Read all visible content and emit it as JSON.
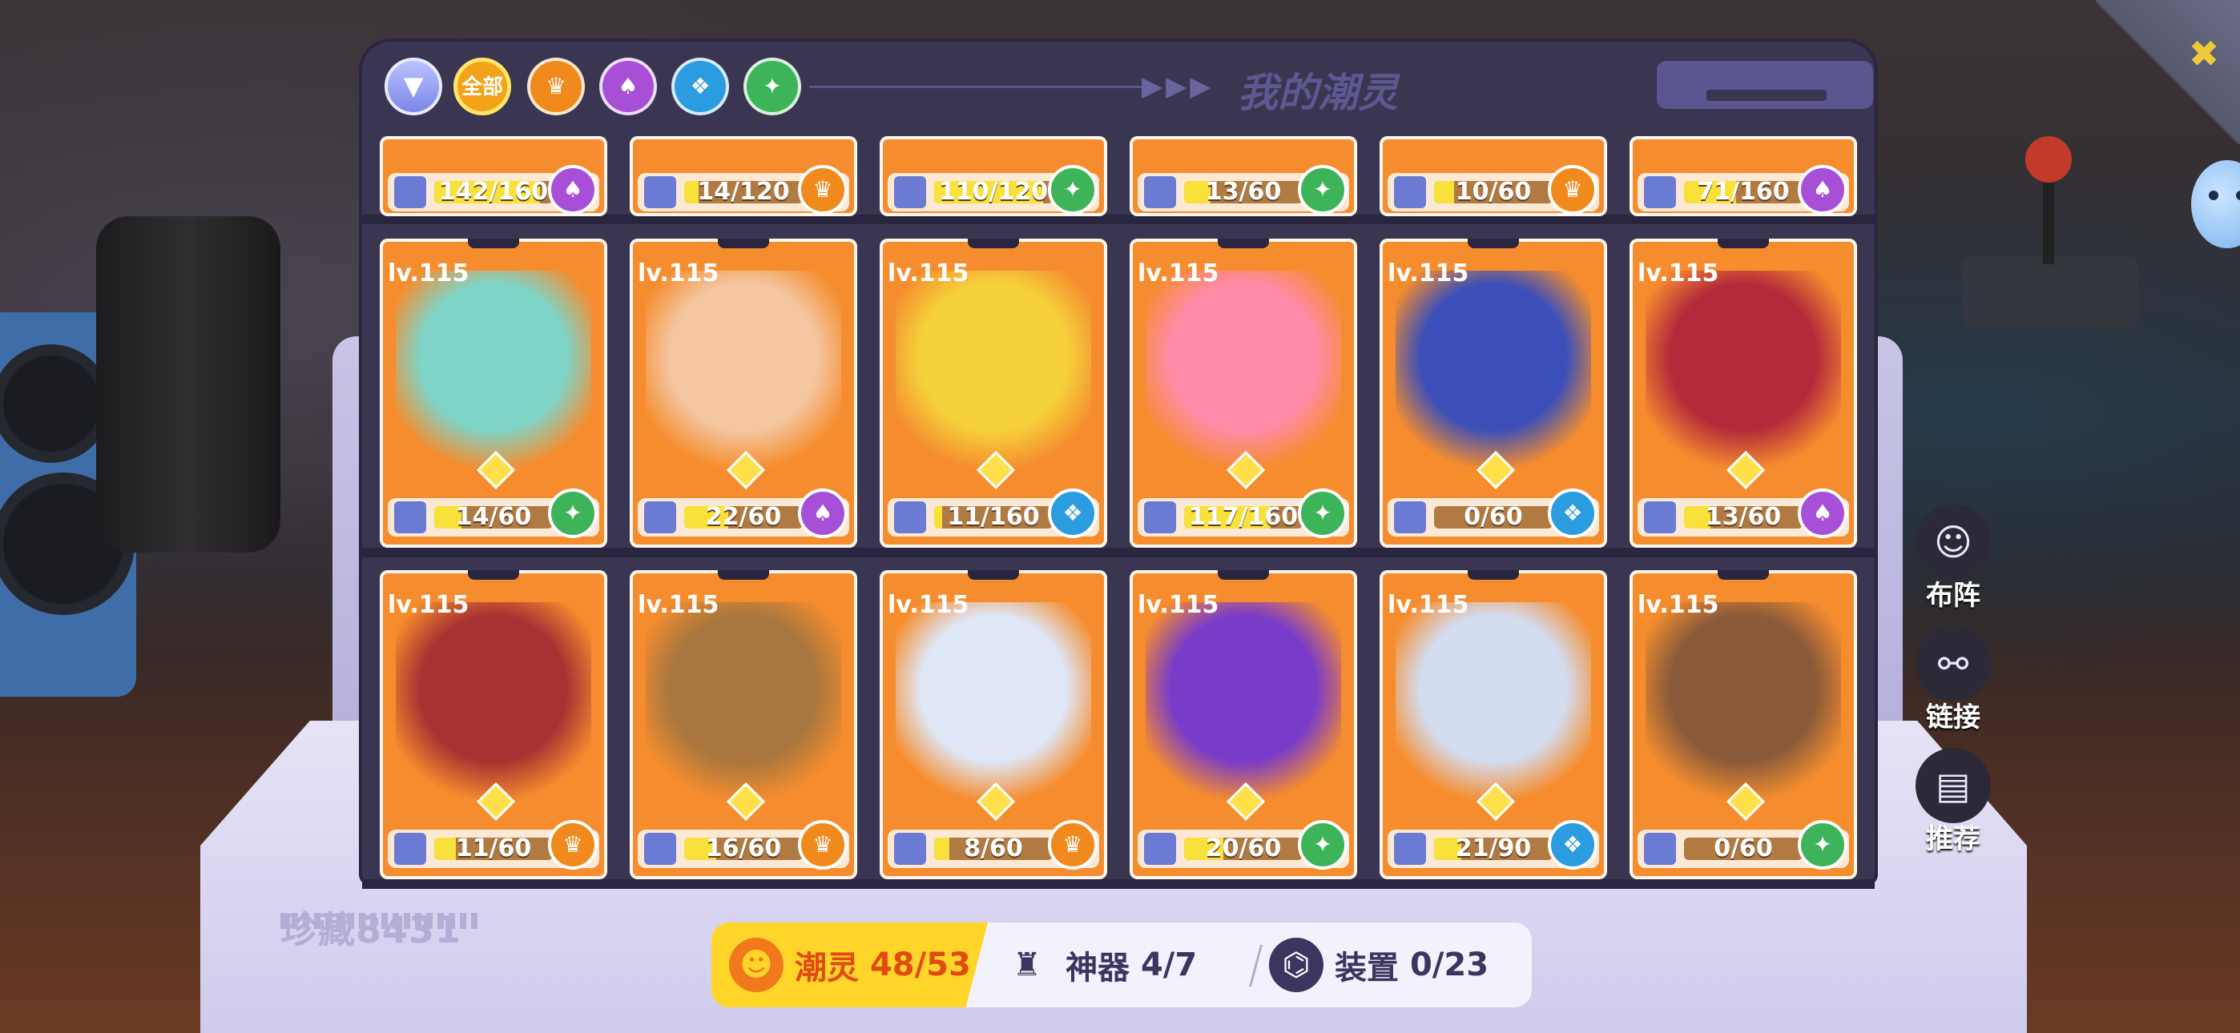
{
  "header": {
    "title": "我的潮灵",
    "filters": [
      {
        "label": "全部",
        "icon": "all-badge",
        "color": "#f2a31a"
      },
      {
        "icon": "orange-faction-icon",
        "color": "#f08a1c"
      },
      {
        "icon": "purple-faction-icon",
        "color": "#a84fd8"
      },
      {
        "icon": "blue-faction-icon",
        "color": "#2a9cdf"
      },
      {
        "icon": "green-faction-icon",
        "color": "#3db45a"
      }
    ]
  },
  "top_row": [
    {
      "count": "142/160",
      "fill": 0.89,
      "faction": "purple"
    },
    {
      "count": "14/120",
      "fill": 0.12,
      "faction": "orange"
    },
    {
      "count": "110/120",
      "fill": 0.92,
      "faction": "green"
    },
    {
      "count": "13/60",
      "fill": 0.22,
      "faction": "green"
    },
    {
      "count": "10/60",
      "fill": 0.17,
      "faction": "orange"
    },
    {
      "count": "71/160",
      "fill": 0.44,
      "faction": "purple"
    }
  ],
  "row1": [
    {
      "level": "lv.115",
      "count": "14/60",
      "fill": 0.23,
      "faction": "green",
      "art": "#7fd4c8"
    },
    {
      "level": "lv.115",
      "count": "22/60",
      "fill": 0.37,
      "faction": "purple",
      "art": "#f4c7a2"
    },
    {
      "level": "lv.115",
      "count": "11/160",
      "fill": 0.07,
      "faction": "blue",
      "art": "#f5d23c"
    },
    {
      "level": "lv.115",
      "count": "117/160",
      "fill": 0.73,
      "faction": "green",
      "art": "#ff8aa8"
    },
    {
      "level": "lv.115",
      "count": "0/60",
      "fill": 0.0,
      "faction": "blue",
      "art": "#3c4fb8"
    },
    {
      "level": "lv.115",
      "count": "13/60",
      "fill": 0.22,
      "faction": "purple",
      "art": "#b52a3a"
    }
  ],
  "row2": [
    {
      "level": "lv.115",
      "count": "11/60",
      "fill": 0.18,
      "faction": "orange",
      "art": "#a83232"
    },
    {
      "level": "lv.115",
      "count": "16/60",
      "fill": 0.27,
      "faction": "orange",
      "art": "#a8763e"
    },
    {
      "level": "lv.115",
      "count": "8/60",
      "fill": 0.13,
      "faction": "orange",
      "art": "#dfe6f5"
    },
    {
      "level": "lv.115",
      "count": "20/60",
      "fill": 0.33,
      "faction": "green",
      "art": "#7a3cc8"
    },
    {
      "level": "lv.115",
      "count": "21/90",
      "fill": 0.23,
      "faction": "blue",
      "art": "#d4dcf0"
    },
    {
      "level": "lv.115",
      "count": "0/60",
      "fill": 0.0,
      "faction": "green",
      "art": "#8a5a3a"
    }
  ],
  "side_menu": {
    "formation": "布阵",
    "link": "链接",
    "recommend": "推荐"
  },
  "collection": {
    "label": "珍藏8431"
  },
  "stats": {
    "spirits_label": "潮灵",
    "spirits_value": "48/53",
    "artifacts_label": "神器",
    "artifacts_value": "4/7",
    "gear_label": "装置",
    "gear_value": "0/23"
  }
}
